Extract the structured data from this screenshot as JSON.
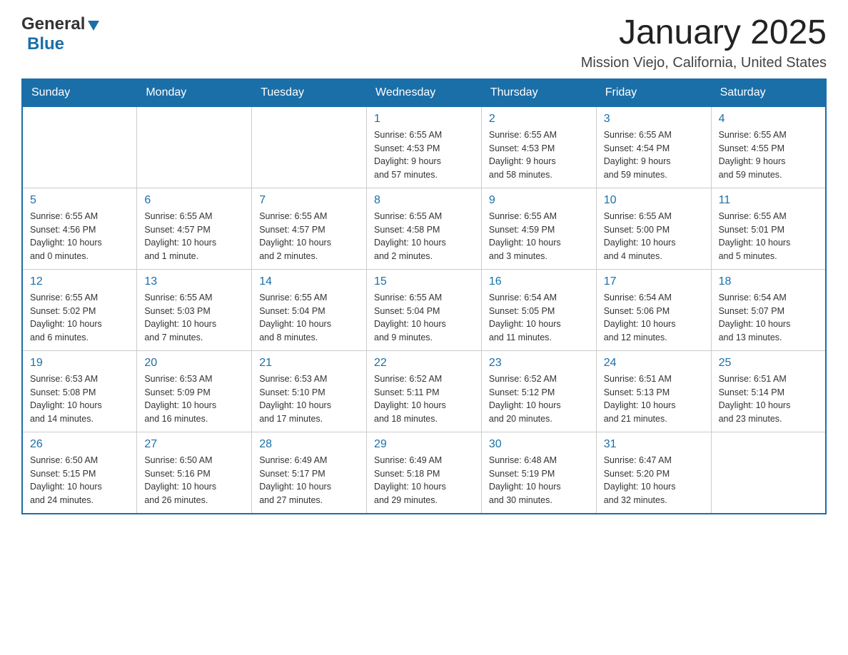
{
  "header": {
    "title": "January 2025",
    "subtitle": "Mission Viejo, California, United States",
    "logo_general": "General",
    "logo_blue": "Blue"
  },
  "days_of_week": [
    "Sunday",
    "Monday",
    "Tuesday",
    "Wednesday",
    "Thursday",
    "Friday",
    "Saturday"
  ],
  "weeks": [
    [
      {
        "num": "",
        "info": ""
      },
      {
        "num": "",
        "info": ""
      },
      {
        "num": "",
        "info": ""
      },
      {
        "num": "1",
        "info": "Sunrise: 6:55 AM\nSunset: 4:53 PM\nDaylight: 9 hours\nand 57 minutes."
      },
      {
        "num": "2",
        "info": "Sunrise: 6:55 AM\nSunset: 4:53 PM\nDaylight: 9 hours\nand 58 minutes."
      },
      {
        "num": "3",
        "info": "Sunrise: 6:55 AM\nSunset: 4:54 PM\nDaylight: 9 hours\nand 59 minutes."
      },
      {
        "num": "4",
        "info": "Sunrise: 6:55 AM\nSunset: 4:55 PM\nDaylight: 9 hours\nand 59 minutes."
      }
    ],
    [
      {
        "num": "5",
        "info": "Sunrise: 6:55 AM\nSunset: 4:56 PM\nDaylight: 10 hours\nand 0 minutes."
      },
      {
        "num": "6",
        "info": "Sunrise: 6:55 AM\nSunset: 4:57 PM\nDaylight: 10 hours\nand 1 minute."
      },
      {
        "num": "7",
        "info": "Sunrise: 6:55 AM\nSunset: 4:57 PM\nDaylight: 10 hours\nand 2 minutes."
      },
      {
        "num": "8",
        "info": "Sunrise: 6:55 AM\nSunset: 4:58 PM\nDaylight: 10 hours\nand 2 minutes."
      },
      {
        "num": "9",
        "info": "Sunrise: 6:55 AM\nSunset: 4:59 PM\nDaylight: 10 hours\nand 3 minutes."
      },
      {
        "num": "10",
        "info": "Sunrise: 6:55 AM\nSunset: 5:00 PM\nDaylight: 10 hours\nand 4 minutes."
      },
      {
        "num": "11",
        "info": "Sunrise: 6:55 AM\nSunset: 5:01 PM\nDaylight: 10 hours\nand 5 minutes."
      }
    ],
    [
      {
        "num": "12",
        "info": "Sunrise: 6:55 AM\nSunset: 5:02 PM\nDaylight: 10 hours\nand 6 minutes."
      },
      {
        "num": "13",
        "info": "Sunrise: 6:55 AM\nSunset: 5:03 PM\nDaylight: 10 hours\nand 7 minutes."
      },
      {
        "num": "14",
        "info": "Sunrise: 6:55 AM\nSunset: 5:04 PM\nDaylight: 10 hours\nand 8 minutes."
      },
      {
        "num": "15",
        "info": "Sunrise: 6:55 AM\nSunset: 5:04 PM\nDaylight: 10 hours\nand 9 minutes."
      },
      {
        "num": "16",
        "info": "Sunrise: 6:54 AM\nSunset: 5:05 PM\nDaylight: 10 hours\nand 11 minutes."
      },
      {
        "num": "17",
        "info": "Sunrise: 6:54 AM\nSunset: 5:06 PM\nDaylight: 10 hours\nand 12 minutes."
      },
      {
        "num": "18",
        "info": "Sunrise: 6:54 AM\nSunset: 5:07 PM\nDaylight: 10 hours\nand 13 minutes."
      }
    ],
    [
      {
        "num": "19",
        "info": "Sunrise: 6:53 AM\nSunset: 5:08 PM\nDaylight: 10 hours\nand 14 minutes."
      },
      {
        "num": "20",
        "info": "Sunrise: 6:53 AM\nSunset: 5:09 PM\nDaylight: 10 hours\nand 16 minutes."
      },
      {
        "num": "21",
        "info": "Sunrise: 6:53 AM\nSunset: 5:10 PM\nDaylight: 10 hours\nand 17 minutes."
      },
      {
        "num": "22",
        "info": "Sunrise: 6:52 AM\nSunset: 5:11 PM\nDaylight: 10 hours\nand 18 minutes."
      },
      {
        "num": "23",
        "info": "Sunrise: 6:52 AM\nSunset: 5:12 PM\nDaylight: 10 hours\nand 20 minutes."
      },
      {
        "num": "24",
        "info": "Sunrise: 6:51 AM\nSunset: 5:13 PM\nDaylight: 10 hours\nand 21 minutes."
      },
      {
        "num": "25",
        "info": "Sunrise: 6:51 AM\nSunset: 5:14 PM\nDaylight: 10 hours\nand 23 minutes."
      }
    ],
    [
      {
        "num": "26",
        "info": "Sunrise: 6:50 AM\nSunset: 5:15 PM\nDaylight: 10 hours\nand 24 minutes."
      },
      {
        "num": "27",
        "info": "Sunrise: 6:50 AM\nSunset: 5:16 PM\nDaylight: 10 hours\nand 26 minutes."
      },
      {
        "num": "28",
        "info": "Sunrise: 6:49 AM\nSunset: 5:17 PM\nDaylight: 10 hours\nand 27 minutes."
      },
      {
        "num": "29",
        "info": "Sunrise: 6:49 AM\nSunset: 5:18 PM\nDaylight: 10 hours\nand 29 minutes."
      },
      {
        "num": "30",
        "info": "Sunrise: 6:48 AM\nSunset: 5:19 PM\nDaylight: 10 hours\nand 30 minutes."
      },
      {
        "num": "31",
        "info": "Sunrise: 6:47 AM\nSunset: 5:20 PM\nDaylight: 10 hours\nand 32 minutes."
      },
      {
        "num": "",
        "info": ""
      }
    ]
  ]
}
